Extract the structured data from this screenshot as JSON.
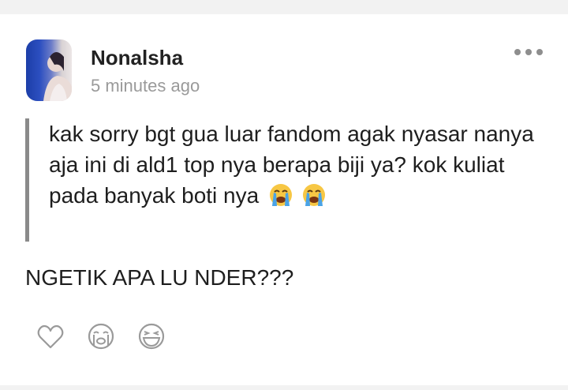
{
  "post": {
    "username": "Nonalsha",
    "timestamp": "5 minutes ago",
    "quote": "kak sorry bgt gua luar fandom agak nyasar nanya aja ini di ald1 top nya berapa biji ya? kok kuliat pada banyak boti nya",
    "quote_emojis": [
      "😭",
      "😭"
    ],
    "reply": "NGETIK APA LU NDER???"
  },
  "icons": {
    "more": "more-horizontal-icon",
    "like": "heart-outline-icon",
    "cry": "crying-face-outline-icon",
    "laugh": "laughing-face-outline-icon"
  },
  "colors": {
    "background": "#f2f2f2",
    "card": "#ffffff",
    "text": "#1e1e1e",
    "muted": "#9a9a9a",
    "quote_bar": "#8a8a8a",
    "icon": "#9a9a9a"
  }
}
